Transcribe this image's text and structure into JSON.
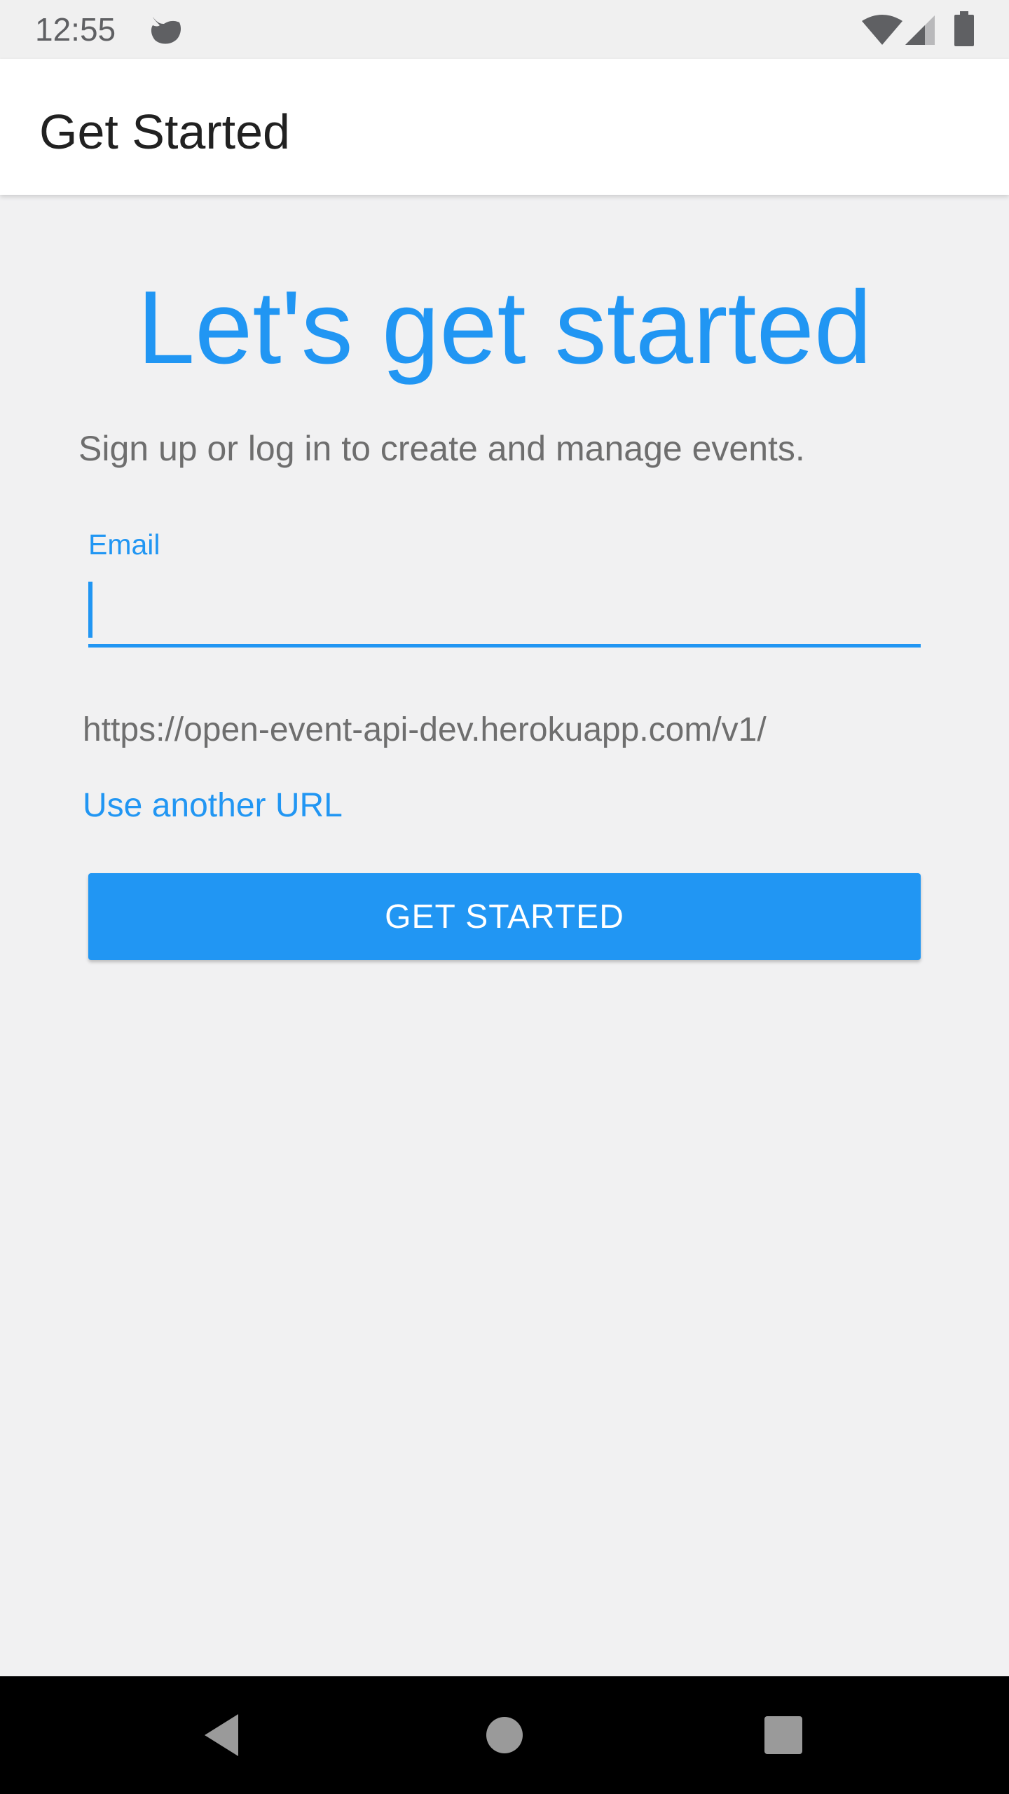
{
  "status_bar": {
    "time": "12:55",
    "icons": [
      "notification-bird-icon",
      "wifi-icon",
      "cell-signal-icon",
      "battery-icon"
    ]
  },
  "app_bar": {
    "title": "Get Started"
  },
  "main": {
    "headline": "Let's get started",
    "subtitle": "Sign up or log in to create and manage events.",
    "email": {
      "label": "Email",
      "value": "",
      "placeholder": ""
    },
    "server_url": "https://open-event-api-dev.herokuapp.com/v1/",
    "another_url_link": "Use another URL",
    "get_started_button": "GET STARTED"
  },
  "nav_bar": {
    "icons": [
      "back-icon",
      "home-icon",
      "recents-icon"
    ]
  },
  "colors": {
    "accent": "#2196f3",
    "background": "#f1f1f2",
    "app_bar": "#ffffff",
    "text_primary": "#212121",
    "text_secondary": "#6e6e6e",
    "nav_bar": "#000000"
  }
}
